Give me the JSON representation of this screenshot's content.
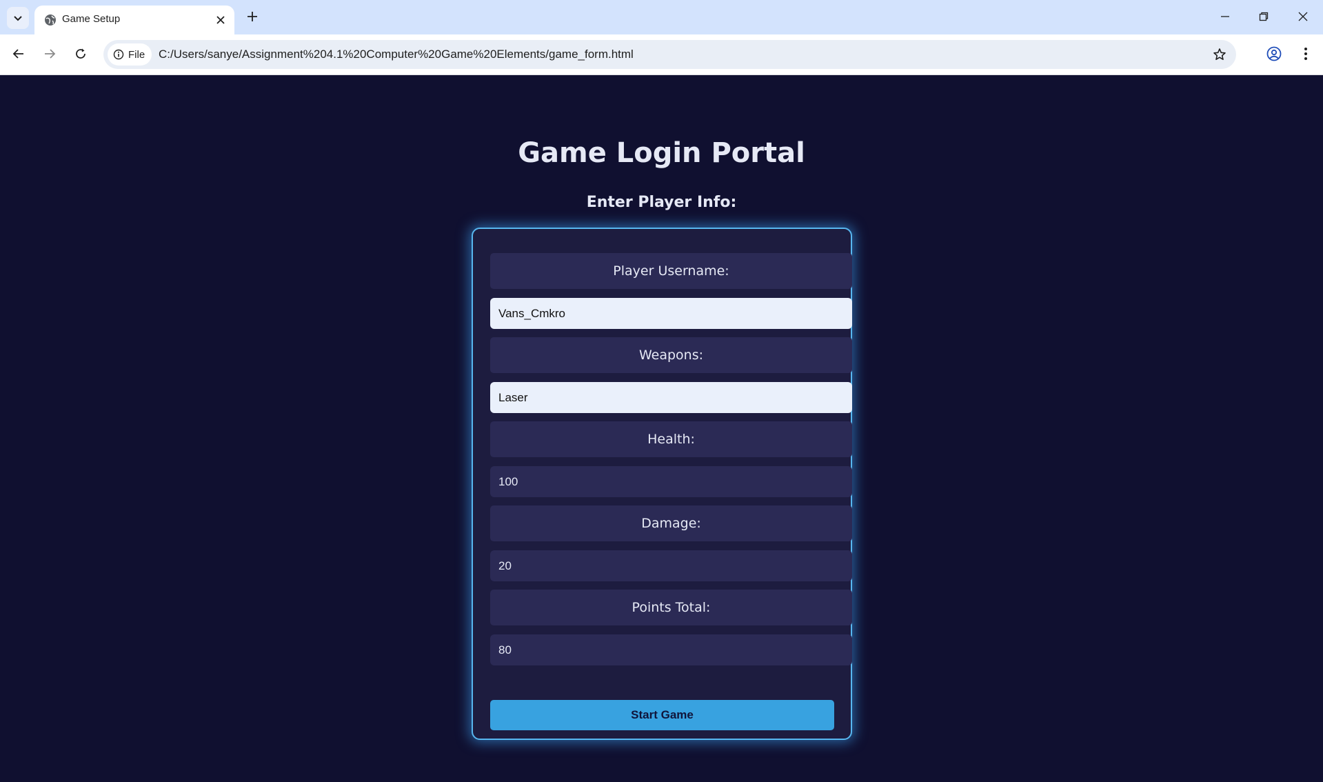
{
  "browser": {
    "tab_title": "Game Setup",
    "site_chip_label": "File",
    "url": "C:/Users/sanye/Assignment%204.1%20Computer%20Game%20Elements/game_form.html"
  },
  "page": {
    "title": "Game Login Portal",
    "subtitle": "Enter Player Info:",
    "fields": [
      {
        "label": "Player Username:",
        "value": "Vans_Cmkro"
      },
      {
        "label": "Weapons:",
        "value": "Laser"
      },
      {
        "label": "Health:",
        "value": "100"
      },
      {
        "label": "Damage:",
        "value": "20"
      },
      {
        "label": "Points Total:",
        "value": "80"
      }
    ],
    "submit_label": "Start Game"
  },
  "colors": {
    "page_background": "#101030",
    "card_background": "#1d1c3f",
    "card_border": "#58b7f0",
    "label_background": "#2b2a55",
    "button_background": "#38a2e0"
  },
  "icons": {
    "tab_search": "chevron-down-icon",
    "favicon": "globe-icon",
    "tab_close": "close-icon",
    "new_tab": "plus-icon",
    "back": "back-arrow-icon",
    "forward": "forward-arrow-icon",
    "reload": "reload-icon",
    "site_info": "info-icon",
    "bookmark": "star-icon",
    "profile": "profile-icon",
    "menu": "kebab-menu-icon",
    "minimize": "minimize-icon",
    "restore": "restore-icon",
    "close_window": "close-window-icon"
  }
}
